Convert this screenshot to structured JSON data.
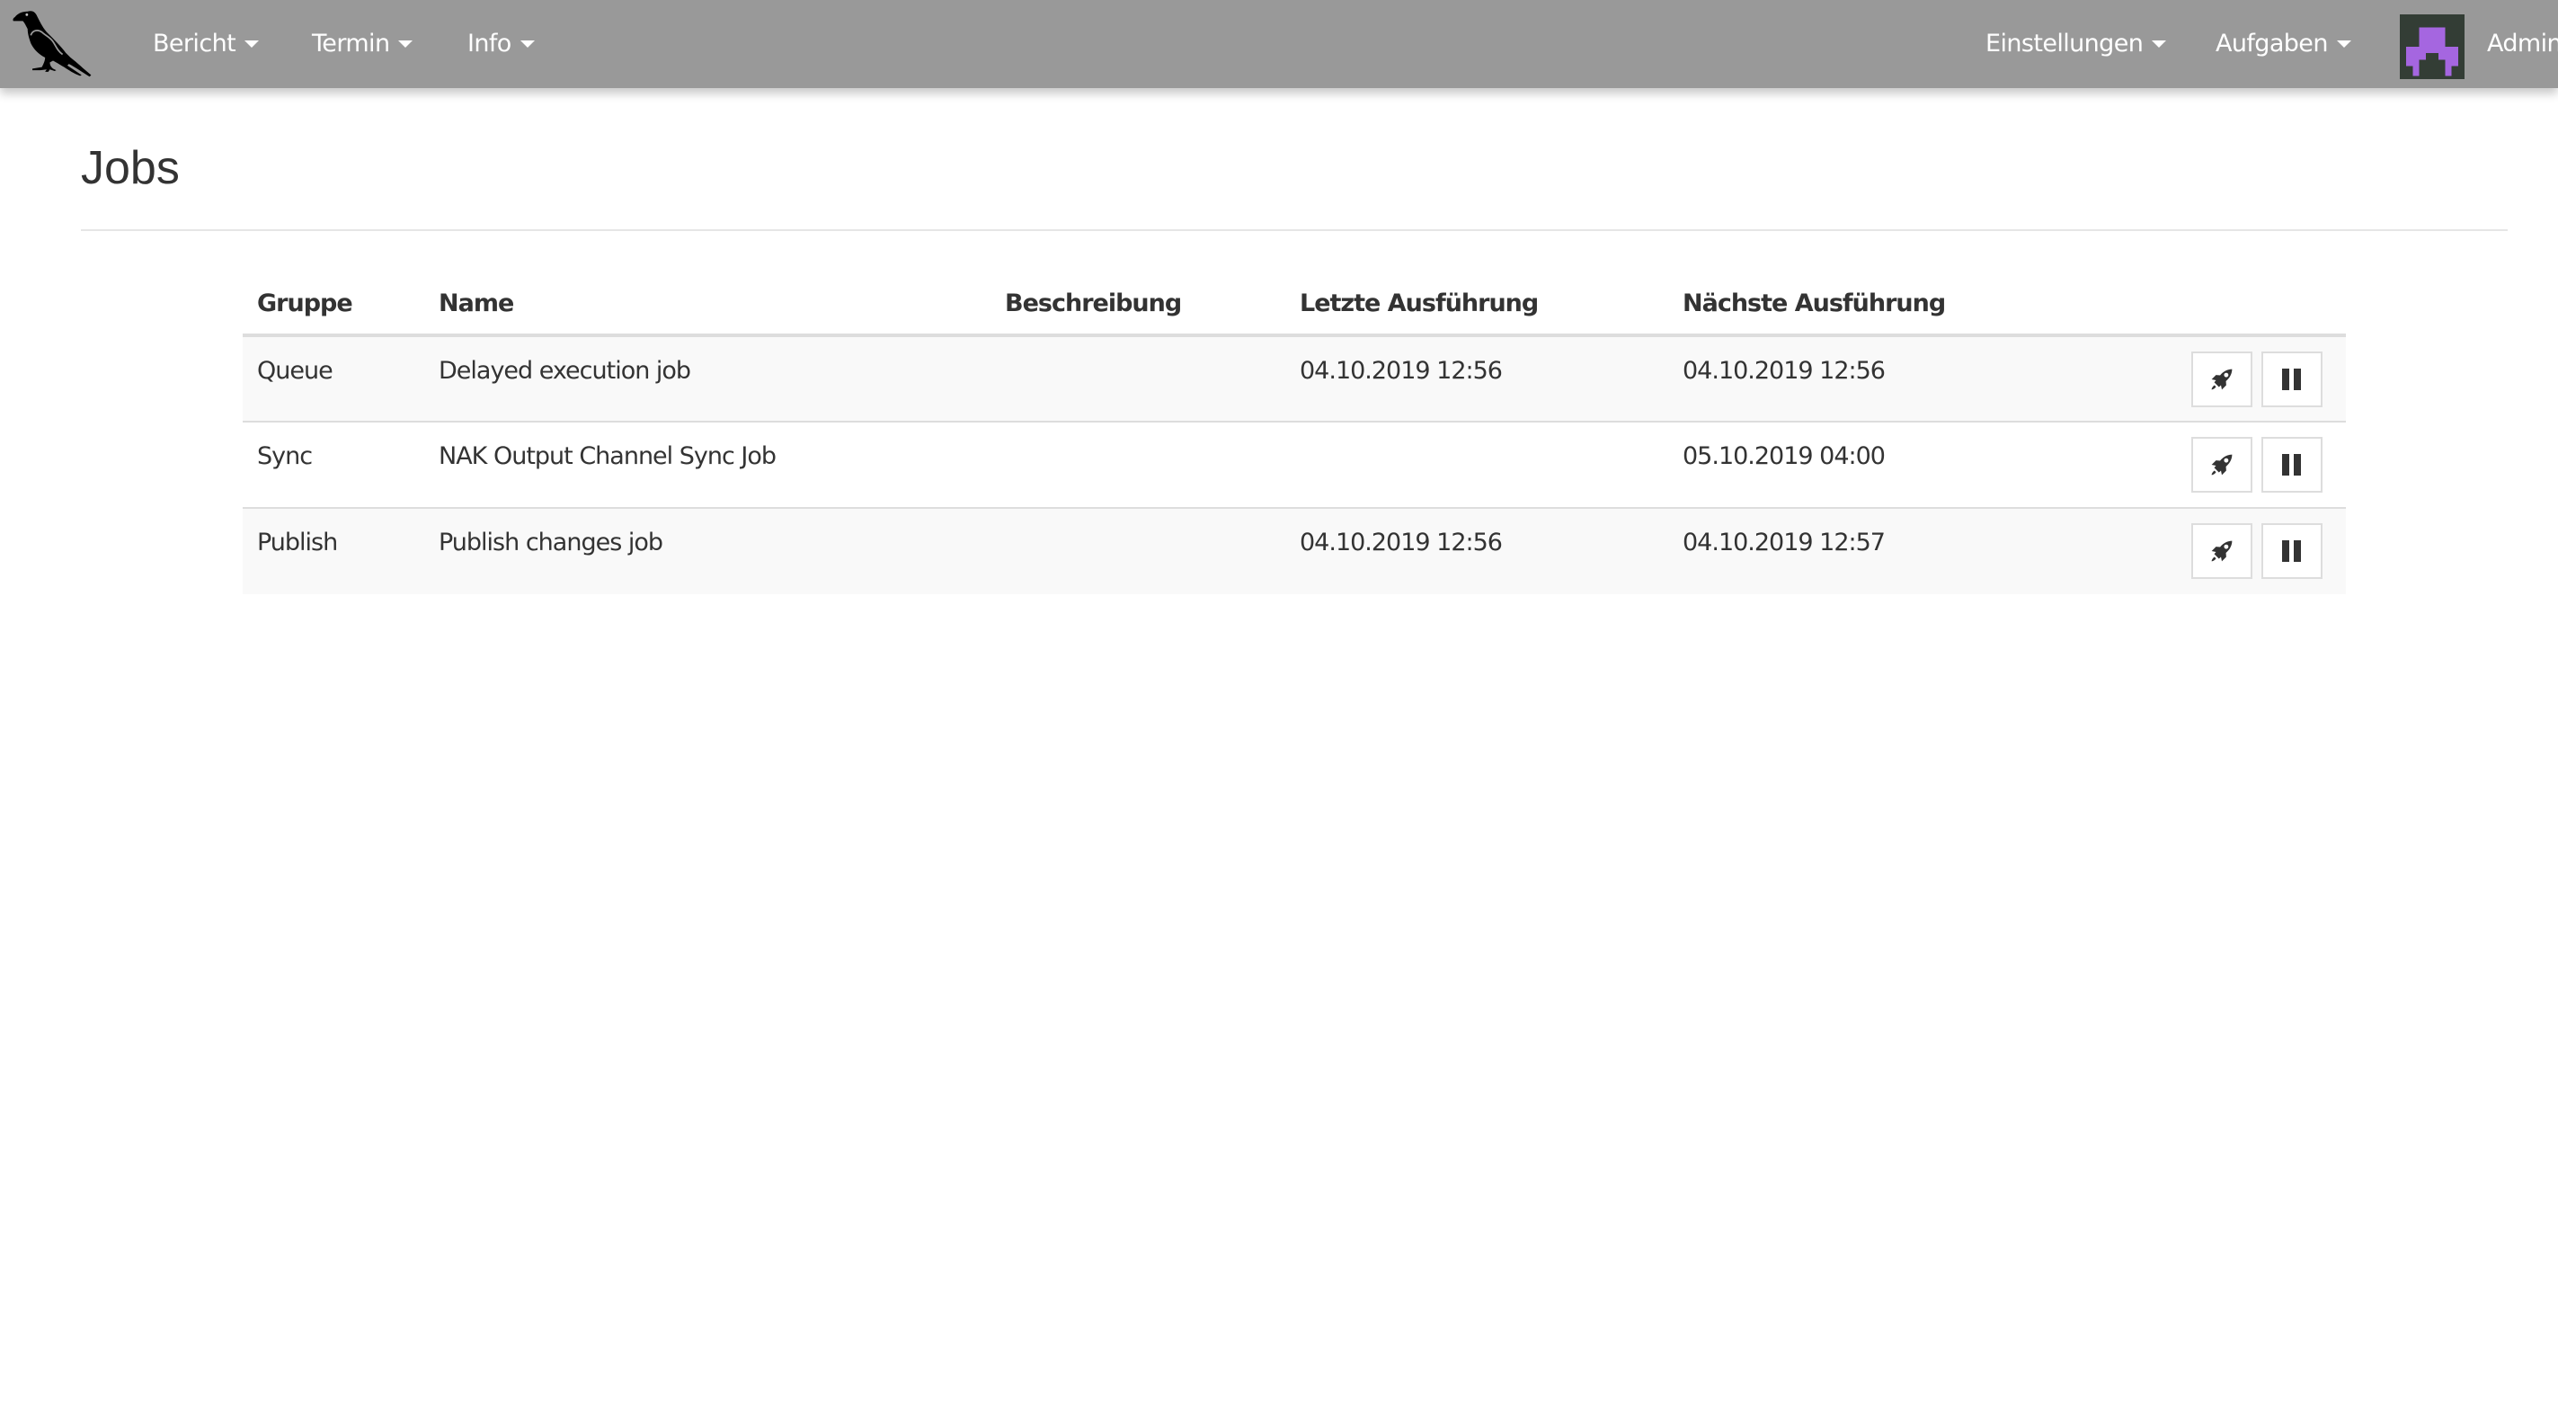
{
  "navbar": {
    "logo_icon": "raven-logo-icon",
    "left_menu": [
      {
        "label": "Bericht",
        "icon": "caret-down-icon"
      },
      {
        "label": "Termin",
        "icon": "caret-down-icon"
      },
      {
        "label": "Info",
        "icon": "caret-down-icon"
      }
    ],
    "right_menu": [
      {
        "label": "Einstellungen",
        "icon": "caret-down-icon"
      },
      {
        "label": "Aufgaben",
        "icon": "caret-down-icon"
      }
    ],
    "user": {
      "name": "Admin",
      "avatar_icon": "identicon-avatar",
      "avatar_bg": "#333d35",
      "avatar_fg": "#a566e0"
    },
    "bg_color": "#999999"
  },
  "page": {
    "title": "Jobs"
  },
  "table": {
    "columns": [
      "Gruppe",
      "Name",
      "Beschreibung",
      "Letzte Ausführung",
      "Nächste Ausführung",
      ""
    ],
    "rows": [
      {
        "group": "Queue",
        "name": "Delayed execution job",
        "description": "",
        "last_run": "04.10.2019 12:56",
        "next_run": "04.10.2019 12:56",
        "actions": [
          {
            "icon": "rocket-icon",
            "action": "run"
          },
          {
            "icon": "pause-icon",
            "action": "pause"
          }
        ]
      },
      {
        "group": "Sync",
        "name": "NAK Output Channel Sync Job",
        "description": "",
        "last_run": "",
        "next_run": "05.10.2019 04:00",
        "actions": [
          {
            "icon": "rocket-icon",
            "action": "run"
          },
          {
            "icon": "pause-icon",
            "action": "pause"
          }
        ]
      },
      {
        "group": "Publish",
        "name": "Publish changes job",
        "description": "",
        "last_run": "04.10.2019 12:56",
        "next_run": "04.10.2019 12:57",
        "actions": [
          {
            "icon": "rocket-icon",
            "action": "run"
          },
          {
            "icon": "pause-icon",
            "action": "pause"
          }
        ]
      }
    ]
  }
}
